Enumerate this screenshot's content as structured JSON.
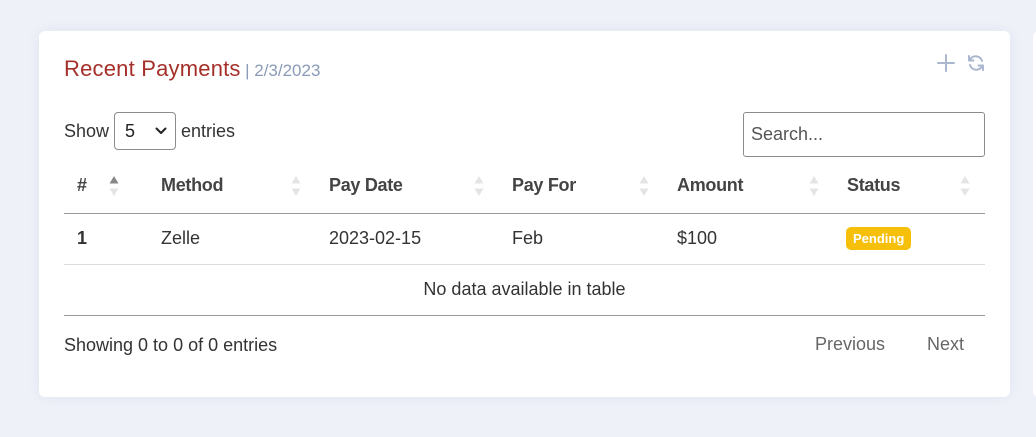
{
  "card": {
    "title": "Recent Payments",
    "subtitle": "| 2/3/2023",
    "tools": {
      "add_icon": "plus-icon",
      "refresh_icon": "refresh-icon"
    }
  },
  "length": {
    "prefix": "Show",
    "value": "5",
    "suffix": "entries"
  },
  "search": {
    "placeholder": "Search..."
  },
  "table": {
    "columns": [
      "#",
      "Method",
      "Pay Date",
      "Pay For",
      "Amount",
      "Status"
    ],
    "rows": [
      {
        "num": "1",
        "method": "Zelle",
        "pay_date": "2023-02-15",
        "pay_for": "Feb",
        "amount": "$100",
        "status": "Pending"
      }
    ],
    "empty_message": "No data available in table"
  },
  "footer": {
    "info": "Showing 0 to 0 of 0 entries",
    "previous": "Previous",
    "next": "Next"
  },
  "colors": {
    "title": "#a5302a",
    "subtitle": "#8a9bb8",
    "status_pending": "#f5bf0a",
    "page_background": "#eef1f8"
  }
}
